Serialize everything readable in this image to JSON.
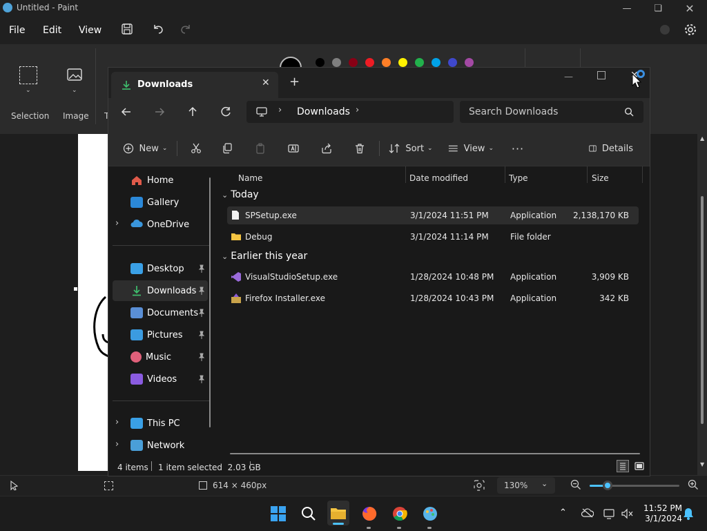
{
  "paint": {
    "title": "Untitled - Paint",
    "menu": [
      "File",
      "Edit",
      "View"
    ],
    "ribbon": {
      "selection": "Selection",
      "image": "Image",
      "tools_partial": "T"
    },
    "palette": [
      "#000000",
      "#7f7f7f",
      "#880015",
      "#ed1c24",
      "#ff7f27",
      "#fff200",
      "#22b14c",
      "#00a2e8",
      "#3f48cc",
      "#a349a4"
    ],
    "status": {
      "canvas_size": "614 × 460px",
      "zoom": "130%"
    }
  },
  "explorer": {
    "tab_title": "Downloads",
    "address": {
      "crumb": "Downloads"
    },
    "search_placeholder": "Search Downloads",
    "toolbar": {
      "new": "New",
      "sort": "Sort",
      "view": "View",
      "details": "Details"
    },
    "nav": {
      "home": "Home",
      "gallery": "Gallery",
      "onedrive": "OneDrive",
      "desktop": "Desktop",
      "downloads": "Downloads",
      "documents": "Documents",
      "pictures": "Pictures",
      "music": "Music",
      "videos": "Videos",
      "thispc": "This PC",
      "network": "Network"
    },
    "columns": {
      "name": "Name",
      "date": "Date modified",
      "type": "Type",
      "size": "Size"
    },
    "groups": {
      "today": "Today",
      "earlier": "Earlier this year"
    },
    "files": [
      {
        "name": "SPSetup.exe",
        "date": "3/1/2024 11:51 PM",
        "type": "Application",
        "size": "2,138,170 KB"
      },
      {
        "name": "Debug",
        "date": "3/1/2024 11:14 PM",
        "type": "File folder",
        "size": ""
      },
      {
        "name": "VisualStudioSetup.exe",
        "date": "1/28/2024 10:48 PM",
        "type": "Application",
        "size": "3,909 KB"
      },
      {
        "name": "Firefox Installer.exe",
        "date": "1/28/2024 10:43 PM",
        "type": "Application",
        "size": "342 KB"
      }
    ],
    "status": {
      "count": "4 items",
      "selected": "1 item selected  2.03 GB"
    }
  },
  "taskbar": {
    "time": "11:52 PM",
    "date": "3/1/2024"
  }
}
